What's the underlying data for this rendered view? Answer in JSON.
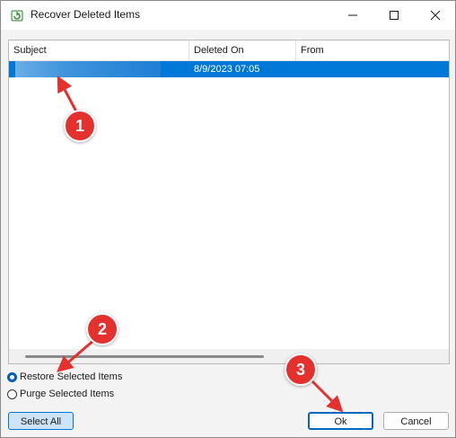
{
  "window": {
    "title": "Recover Deleted Items"
  },
  "columns": [
    "Subject",
    "Deleted On",
    "From"
  ],
  "rows": [
    {
      "subject": "",
      "deleted_on": "8/9/2023 07:05",
      "from": "",
      "selected": true
    }
  ],
  "options": {
    "restore_label": "Restore Selected Items",
    "purge_label": "Purge Selected Items",
    "selected": "restore"
  },
  "buttons": {
    "select_all": "Select All",
    "ok": "Ok",
    "cancel": "Cancel"
  },
  "annotations": [
    "1",
    "2",
    "3"
  ],
  "colors": {
    "selection": "#0078d7",
    "badge": "#e5312e"
  },
  "icons": {
    "app": "recover-items-icon",
    "minimize": "minimize-icon",
    "maximize": "maximize-icon",
    "close": "close-icon"
  }
}
